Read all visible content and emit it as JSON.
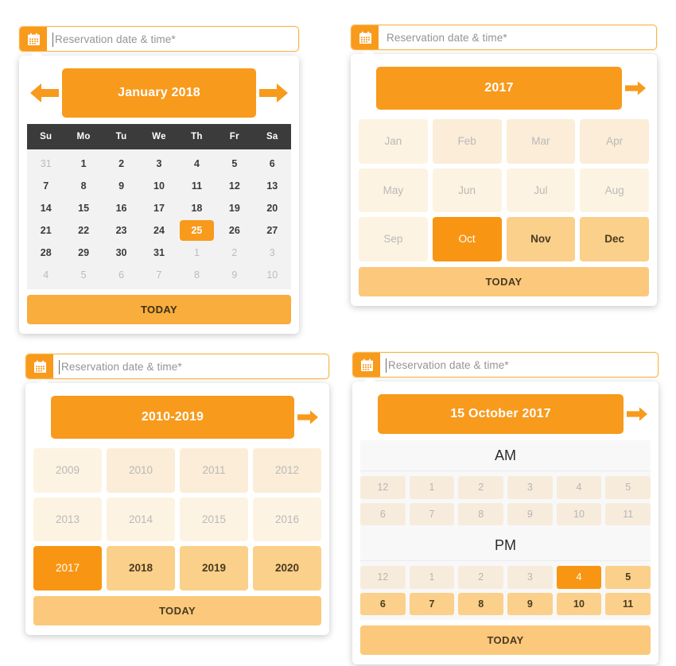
{
  "colors": {
    "accent": "#f89a1c",
    "accent_selected": "#f89613",
    "accent_soft": "#fad08a",
    "accent_pale": "#fdf3e2",
    "header_dark": "#3b3b3b",
    "today_strong": "#f9ad3c",
    "today_soft": "#fbc87c",
    "body_gray": "#f2f2f2"
  },
  "field": {
    "icon": "calendar-icon",
    "placeholder": "Reservation date & time*",
    "value": ""
  },
  "labels": {
    "today": "TODAY",
    "prev_arrow": "arrow-left-icon",
    "next_arrow": "arrow-right-icon"
  },
  "panels": {
    "day_picker": {
      "title": "January 2018",
      "has_prev": true,
      "has_next": true,
      "weekdays": [
        "Su",
        "Mo",
        "Tu",
        "We",
        "Th",
        "Fr",
        "Sa"
      ],
      "today_label": "TODAY",
      "weeks": [
        [
          {
            "n": "31",
            "state": "muted"
          },
          {
            "n": "1",
            "state": "normal"
          },
          {
            "n": "2",
            "state": "normal"
          },
          {
            "n": "3",
            "state": "normal"
          },
          {
            "n": "4",
            "state": "normal"
          },
          {
            "n": "5",
            "state": "normal"
          },
          {
            "n": "6",
            "state": "normal"
          }
        ],
        [
          {
            "n": "7",
            "state": "normal"
          },
          {
            "n": "8",
            "state": "normal"
          },
          {
            "n": "9",
            "state": "normal"
          },
          {
            "n": "10",
            "state": "normal"
          },
          {
            "n": "11",
            "state": "normal"
          },
          {
            "n": "12",
            "state": "normal"
          },
          {
            "n": "13",
            "state": "normal"
          }
        ],
        [
          {
            "n": "14",
            "state": "normal"
          },
          {
            "n": "15",
            "state": "normal"
          },
          {
            "n": "16",
            "state": "normal"
          },
          {
            "n": "17",
            "state": "normal"
          },
          {
            "n": "18",
            "state": "normal"
          },
          {
            "n": "19",
            "state": "normal"
          },
          {
            "n": "20",
            "state": "normal"
          }
        ],
        [
          {
            "n": "21",
            "state": "normal"
          },
          {
            "n": "22",
            "state": "normal"
          },
          {
            "n": "23",
            "state": "normal"
          },
          {
            "n": "24",
            "state": "normal"
          },
          {
            "n": "25",
            "state": "selected"
          },
          {
            "n": "26",
            "state": "normal"
          },
          {
            "n": "27",
            "state": "normal"
          }
        ],
        [
          {
            "n": "28",
            "state": "normal"
          },
          {
            "n": "29",
            "state": "normal"
          },
          {
            "n": "30",
            "state": "normal"
          },
          {
            "n": "31",
            "state": "normal"
          },
          {
            "n": "1",
            "state": "muted"
          },
          {
            "n": "2",
            "state": "muted"
          },
          {
            "n": "3",
            "state": "muted"
          }
        ],
        [
          {
            "n": "4",
            "state": "muted"
          },
          {
            "n": "5",
            "state": "muted"
          },
          {
            "n": "6",
            "state": "muted"
          },
          {
            "n": "7",
            "state": "muted"
          },
          {
            "n": "8",
            "state": "muted"
          },
          {
            "n": "9",
            "state": "muted"
          },
          {
            "n": "10",
            "state": "muted"
          }
        ]
      ]
    },
    "month_picker": {
      "title": "2017",
      "has_prev": false,
      "has_next": true,
      "today_label": "TODAY",
      "cells": [
        {
          "label": "Jan",
          "state": "lvl0"
        },
        {
          "label": "Feb",
          "state": "lvl1"
        },
        {
          "label": "Mar",
          "state": "lvl1"
        },
        {
          "label": "Apr",
          "state": "lvl1"
        },
        {
          "label": "May",
          "state": "lvl0"
        },
        {
          "label": "Jun",
          "state": "lvl0"
        },
        {
          "label": "Jul",
          "state": "lvl0"
        },
        {
          "label": "Aug",
          "state": "lvl0"
        },
        {
          "label": "Sep",
          "state": "lvl0"
        },
        {
          "label": "Oct",
          "state": "selected"
        },
        {
          "label": "Nov",
          "state": "lvl2"
        },
        {
          "label": "Dec",
          "state": "lvl2"
        }
      ]
    },
    "year_picker": {
      "title": "2010-2019",
      "has_prev": false,
      "has_next": true,
      "today_label": "TODAY",
      "cells": [
        {
          "label": "2009",
          "state": "lvl0"
        },
        {
          "label": "2010",
          "state": "lvl1"
        },
        {
          "label": "2011",
          "state": "lvl1"
        },
        {
          "label": "2012",
          "state": "lvl1"
        },
        {
          "label": "2013",
          "state": "lvl0"
        },
        {
          "label": "2014",
          "state": "lvl0"
        },
        {
          "label": "2015",
          "state": "lvl0"
        },
        {
          "label": "2016",
          "state": "lvl0"
        },
        {
          "label": "2017",
          "state": "selected"
        },
        {
          "label": "2018",
          "state": "lvl2"
        },
        {
          "label": "2019",
          "state": "lvl2"
        },
        {
          "label": "2020",
          "state": "lvl2"
        }
      ]
    },
    "time_picker": {
      "title": "15 October 2017",
      "has_prev": false,
      "has_next": true,
      "today_label": "TODAY",
      "am_label": "AM",
      "pm_label": "PM",
      "am_cells": [
        {
          "label": "12",
          "state": "lvl0"
        },
        {
          "label": "1",
          "state": "lvl0"
        },
        {
          "label": "2",
          "state": "lvl0"
        },
        {
          "label": "3",
          "state": "lvl0"
        },
        {
          "label": "4",
          "state": "lvl0"
        },
        {
          "label": "5",
          "state": "lvl0"
        },
        {
          "label": "6",
          "state": "lvl0"
        },
        {
          "label": "7",
          "state": "lvl0"
        },
        {
          "label": "8",
          "state": "lvl0"
        },
        {
          "label": "9",
          "state": "lvl0"
        },
        {
          "label": "10",
          "state": "lvl0"
        },
        {
          "label": "11",
          "state": "lvl0"
        }
      ],
      "pm_cells": [
        {
          "label": "12",
          "state": "lvl0"
        },
        {
          "label": "1",
          "state": "lvl0"
        },
        {
          "label": "2",
          "state": "lvl0"
        },
        {
          "label": "3",
          "state": "lvl0"
        },
        {
          "label": "4",
          "state": "selected"
        },
        {
          "label": "5",
          "state": "lvl2"
        },
        {
          "label": "6",
          "state": "lvl2"
        },
        {
          "label": "7",
          "state": "lvl2"
        },
        {
          "label": "8",
          "state": "lvl2"
        },
        {
          "label": "9",
          "state": "lvl2"
        },
        {
          "label": "10",
          "state": "lvl2"
        },
        {
          "label": "11",
          "state": "lvl2"
        }
      ]
    }
  }
}
